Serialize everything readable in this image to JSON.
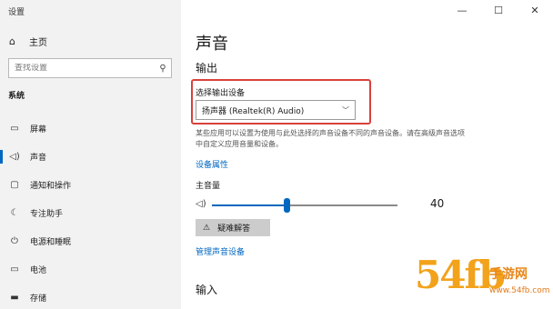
{
  "window": {
    "title": "设置",
    "minimize_glyph": "—",
    "maximize_glyph": "☐",
    "close_glyph": "✕"
  },
  "sidebar": {
    "home_label": "主页",
    "search_placeholder": "查找设置",
    "section_label": "系统",
    "items": [
      {
        "label": "屏幕",
        "icon": "display-icon",
        "glyph": "▭"
      },
      {
        "label": "声音",
        "icon": "speaker-icon",
        "glyph": "🔈",
        "active": true
      },
      {
        "label": "通知和操作",
        "icon": "notification-icon",
        "glyph": "▢"
      },
      {
        "label": "专注助手",
        "icon": "moon-icon",
        "glyph": "☾"
      },
      {
        "label": "电源和睡眠",
        "icon": "power-icon",
        "glyph": "⏻"
      },
      {
        "label": "电池",
        "icon": "battery-icon",
        "glyph": "▭"
      },
      {
        "label": "存储",
        "icon": "storage-icon",
        "glyph": "▬"
      }
    ]
  },
  "main": {
    "title": "声音",
    "output_heading": "输出",
    "device_label": "选择输出设备",
    "device_value": "扬声器 (Realtek(R) Audio)",
    "description": "某些应用可以设置为使用与此处选择的声音设备不同的声音设备。请在高级声音选项中自定义应用音量和设备。",
    "device_properties_link": "设备属性",
    "master_volume_label": "主音量",
    "volume": 40,
    "troubleshoot_label": "疑难解答",
    "manage_devices_link": "管理声音设备",
    "input_heading": "输入"
  },
  "watermark": {
    "big": "54fb",
    "small": "手游网",
    "url": "www.54fb.com"
  },
  "colors": {
    "accent": "#0067c0",
    "highlight_box": "#d9413b",
    "watermark": "#f2a21b"
  }
}
